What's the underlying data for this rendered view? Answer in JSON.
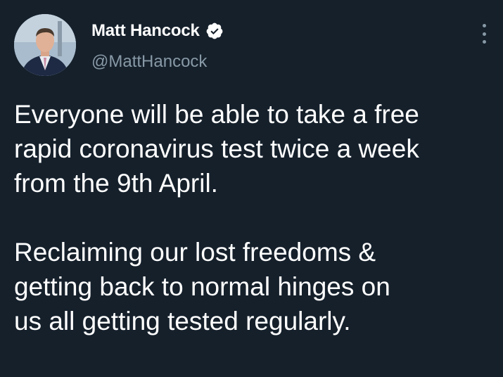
{
  "author": {
    "display_name": "Matt Hancock",
    "handle": "@MattHancock",
    "verified": true
  },
  "icons": {
    "verified": "verified-badge-icon",
    "more": "more-options-icon"
  },
  "tweet": {
    "paragraph_1": "Everyone will be able to take a free\nrapid coronavirus test twice a week\nfrom the 9th April.",
    "paragraph_2": "Reclaiming our lost freedoms &\ngetting back to normal hinges on\nus all getting tested regularly."
  },
  "colors": {
    "background": "#15202b",
    "text_primary": "#ffffff",
    "text_secondary": "#8899a6"
  }
}
